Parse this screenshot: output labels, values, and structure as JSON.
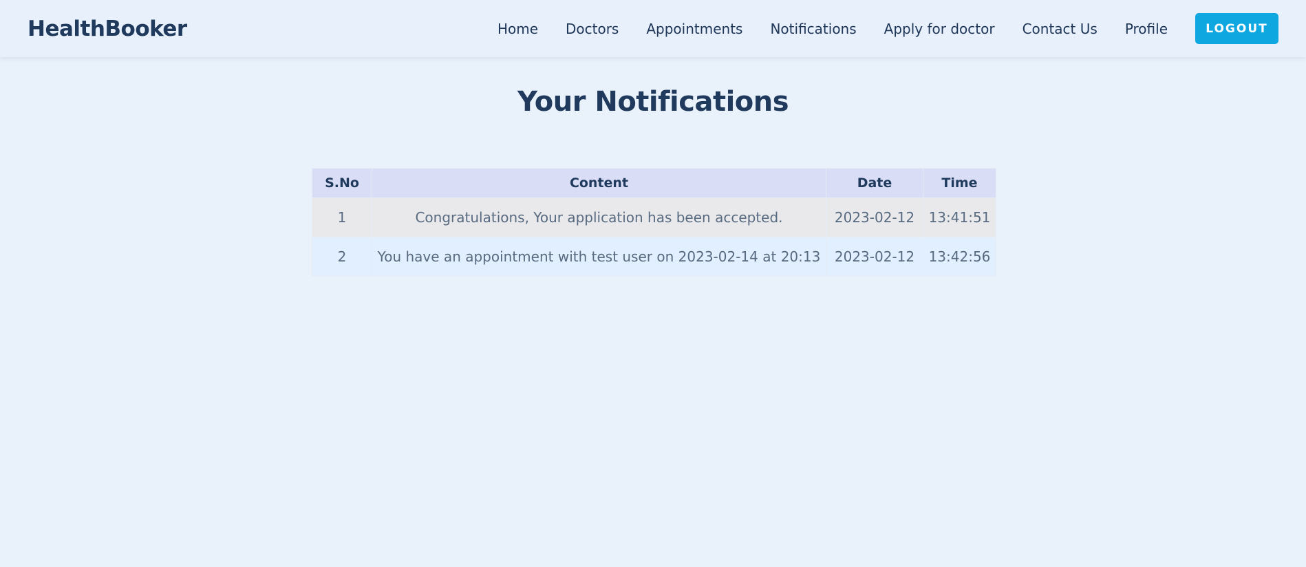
{
  "brand": {
    "name": "HealthBooker"
  },
  "nav": {
    "items": [
      {
        "label": "Home"
      },
      {
        "label": "Doctors"
      },
      {
        "label": "Appointments"
      },
      {
        "label": "Notifications"
      },
      {
        "label": "Apply for doctor"
      },
      {
        "label": "Contact Us"
      },
      {
        "label": "Profile"
      }
    ],
    "logout_label": "LOGOUT"
  },
  "main": {
    "title": "Your Notifications",
    "table": {
      "headers": [
        "S.No",
        "Content",
        "Date",
        "Time"
      ],
      "rows": [
        [
          "1",
          "Congratulations, Your application has been accepted.",
          "2023-02-12",
          "13:41:51"
        ],
        [
          "2",
          "You have an appointment with test user on 2023-02-14 at 20:13",
          "2023-02-12",
          "13:42:56"
        ]
      ]
    }
  },
  "colors": {
    "background": "#e9f1fb",
    "accent": "#0fa7e0",
    "heading": "#1f3a5c",
    "table_header": "#d9def6"
  }
}
